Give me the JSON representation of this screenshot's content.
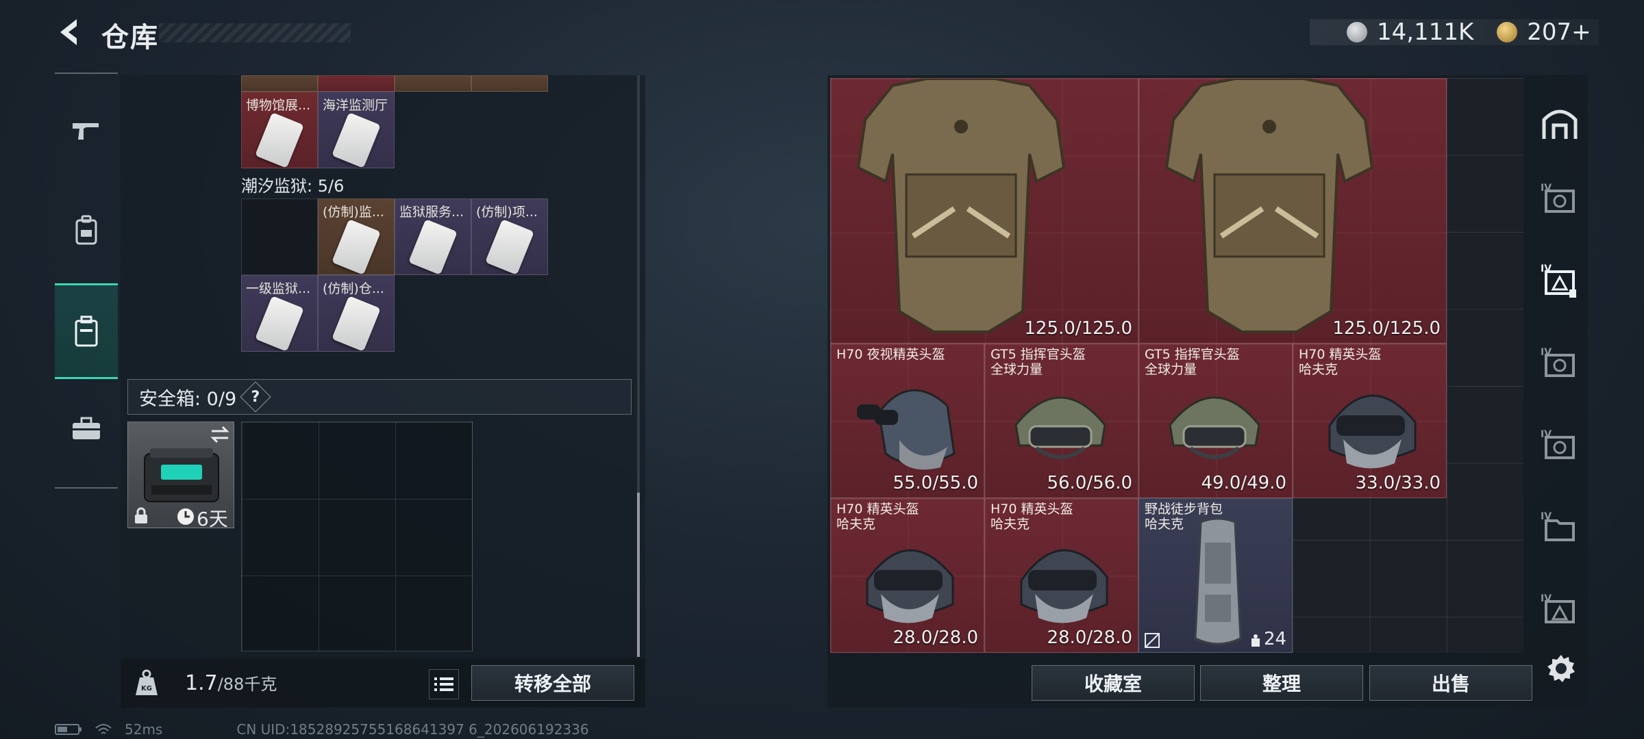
{
  "header": {
    "title": "仓库",
    "currency1_value": "14,111K",
    "currency2_value": "207",
    "currency2_plus": "+"
  },
  "left_nav": {
    "items": [
      {
        "icon": "gun-icon"
      },
      {
        "icon": "backpack-icon"
      },
      {
        "icon": "storage-case-icon",
        "active": true
      },
      {
        "icon": "briefcase-icon"
      }
    ]
  },
  "keycards": {
    "row_top_labels": [
      "博物馆展...",
      "海洋监测厅"
    ],
    "prison_label": "潮汐监狱: 5/6",
    "prison_cards": [
      "(仿制)监...",
      "监狱服务...",
      "(仿制)项...",
      "一级监狱...",
      "(仿制)仓..."
    ]
  },
  "safe_box": {
    "label": "安全箱: 0/9",
    "help": "?",
    "duration": "6天"
  },
  "bottom_left": {
    "weight_current": "1.7",
    "weight_max": "/88千克",
    "transfer_all": "转移全部"
  },
  "items": [
    {
      "name": "",
      "durability": "125.0/125.0"
    },
    {
      "name": "",
      "durability": "125.0/125.0"
    },
    {
      "name": "H70 夜视精英头盔",
      "durability": "55.0/55.0"
    },
    {
      "name": "GT5 指挥官头盔\n全球力量",
      "durability": "56.0/56.0"
    },
    {
      "name": "GT5 指挥官头盔\n全球力量",
      "durability": "49.0/49.0"
    },
    {
      "name": "H70 精英头盔\n哈夫克",
      "durability": "33.0/33.0"
    },
    {
      "name": "H70 精英头盔\n哈夫克",
      "durability": "28.0/28.0"
    },
    {
      "name": "H70 精英头盔\n哈夫克",
      "durability": "28.0/28.0"
    },
    {
      "name": "野战徒步背包\n哈夫克",
      "capacity": "24"
    }
  ],
  "right_buttons": {
    "collection": "收藏室",
    "organize": "整理",
    "sell": "出售"
  },
  "right_side_nav": [
    "vault-icon",
    "IV",
    "IV",
    "IV",
    "IV",
    "IV",
    "IV"
  ],
  "status": {
    "ping": "52ms",
    "uid": "CN UID:18528925755168641397 6_202606192336"
  },
  "colors": {
    "accent": "#3ad6b5",
    "red_cell": "#6d2933",
    "purple_cell": "#3f3a58",
    "navy_cell": "#3a3e55"
  }
}
